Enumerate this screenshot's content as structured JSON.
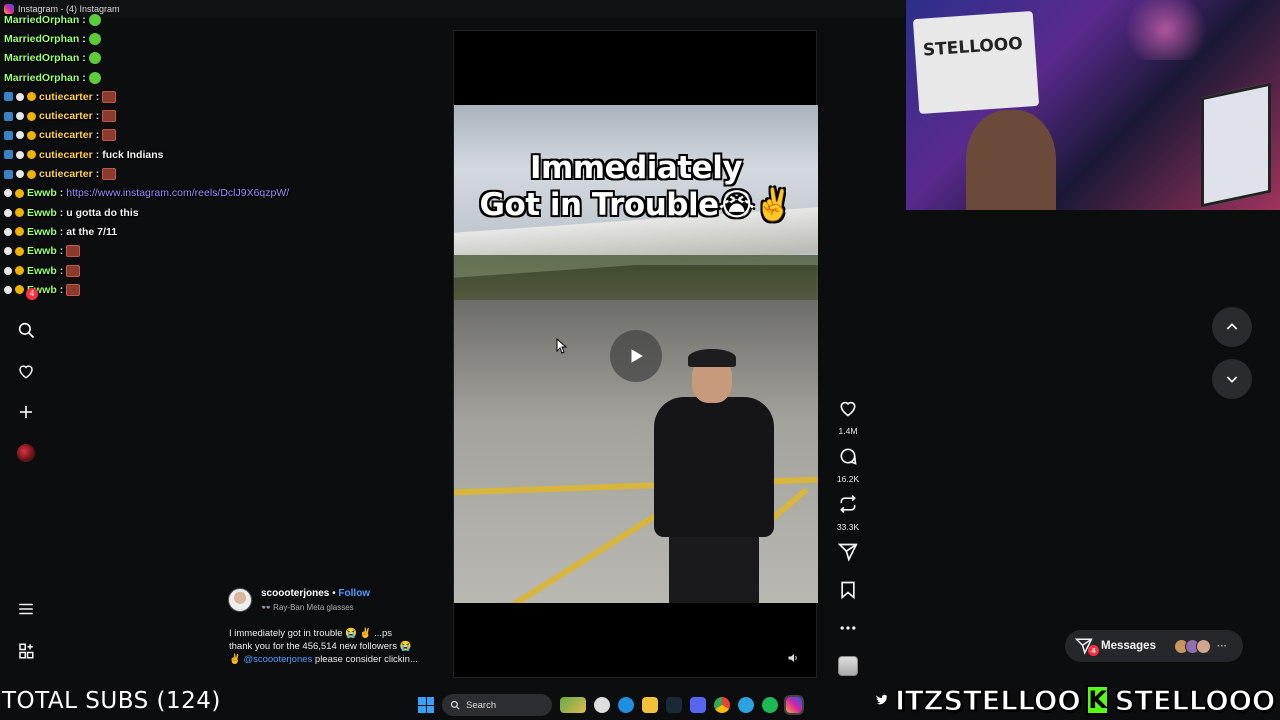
{
  "window": {
    "title": "Instagram - (4) Instagram"
  },
  "chat": [
    {
      "user": "MarriedOrphan",
      "color": "green",
      "badges": [],
      "message": "",
      "emote": "green"
    },
    {
      "user": "MarriedOrphan",
      "color": "green",
      "badges": [],
      "message": "",
      "emote": "green"
    },
    {
      "user": "MarriedOrphan",
      "color": "green",
      "badges": [],
      "message": "",
      "emote": "green"
    },
    {
      "user": "MarriedOrphan",
      "color": "green",
      "badges": [],
      "message": "",
      "emote": "green"
    },
    {
      "user": "cutiecarter",
      "color": "yellow",
      "badges": [
        "b1",
        "b2",
        "b3"
      ],
      "message": "",
      "emote": "red"
    },
    {
      "user": "cutiecarter",
      "color": "yellow",
      "badges": [
        "b1",
        "b2",
        "b3"
      ],
      "message": "",
      "emote": "red"
    },
    {
      "user": "cutiecarter",
      "color": "yellow",
      "badges": [
        "b1",
        "b2",
        "b3"
      ],
      "message": "",
      "emote": "red"
    },
    {
      "user": "cutiecarter",
      "color": "yellow",
      "badges": [
        "b1",
        "b2",
        "b3"
      ],
      "message": "fuck Indians",
      "emote": ""
    },
    {
      "user": "cutiecarter",
      "color": "yellow",
      "badges": [
        "b1",
        "b2",
        "b3"
      ],
      "message": "",
      "emote": "red"
    },
    {
      "user": "Ewwb",
      "color": "green",
      "badges": [
        "b2",
        "b3"
      ],
      "message": "https://www.instagram.com/reels/DclJ9X6qzpW/",
      "link": true,
      "emote": ""
    },
    {
      "user": "Ewwb",
      "color": "green",
      "badges": [
        "b2",
        "b3"
      ],
      "message": "u gotta do this",
      "emote": ""
    },
    {
      "user": "Ewwb",
      "color": "green",
      "badges": [
        "b2",
        "b3"
      ],
      "message": "at the 7/11",
      "emote": ""
    },
    {
      "user": "Ewwb",
      "color": "green",
      "badges": [
        "b2",
        "b3"
      ],
      "message": "",
      "emote": "red"
    },
    {
      "user": "Ewwb",
      "color": "green",
      "badges": [
        "b2",
        "b3"
      ],
      "message": "",
      "emote": "red"
    },
    {
      "user": "Ewwb",
      "color": "green",
      "badges": [
        "b2",
        "b3"
      ],
      "message": "",
      "emote": "red"
    }
  ],
  "left_nav": {
    "icons": [
      "search-icon",
      "heart-icon",
      "plus-icon",
      "profile-avatar",
      "menu-icon",
      "grid-icon"
    ],
    "notification_count": "4"
  },
  "reel": {
    "overlay_line1": "Immediately",
    "overlay_line2": "Got in Trouble😭✌️",
    "likes": "1.4M",
    "comments": "16.2K",
    "reposts": "33.3K"
  },
  "post": {
    "username": "scoooterjones",
    "separator": " • ",
    "follow": "Follow",
    "subtitle": "👓 Ray-Ban Meta glasses",
    "caption_line1": "I immediately got in trouble 😭 ✌️ ...ps",
    "caption_line2": "thank you for the 456,514 new followers 😭",
    "caption_line3_prefix": "✌️ ",
    "caption_mention": "@scoooterjones",
    "caption_line3_suffix": " please consider clickin..."
  },
  "messages": {
    "label": "Messages",
    "badge": "4",
    "more": "···"
  },
  "overlay": {
    "total_subs": "TOTAL SUBS (124)",
    "twitter_handle": "ITZSTELLOO",
    "kick_handle": "STELLOOO",
    "kick_letter": "K"
  },
  "webcam": {
    "poster_text": "STELLOOO"
  },
  "taskbar": {
    "search_label": "Search"
  },
  "colors": {
    "accent_blue": "#4f9dff",
    "notification_red": "#ff3040",
    "kick_green": "#53fc18",
    "chat_green": "#9cff74",
    "chat_yellow": "#ffd24a"
  }
}
